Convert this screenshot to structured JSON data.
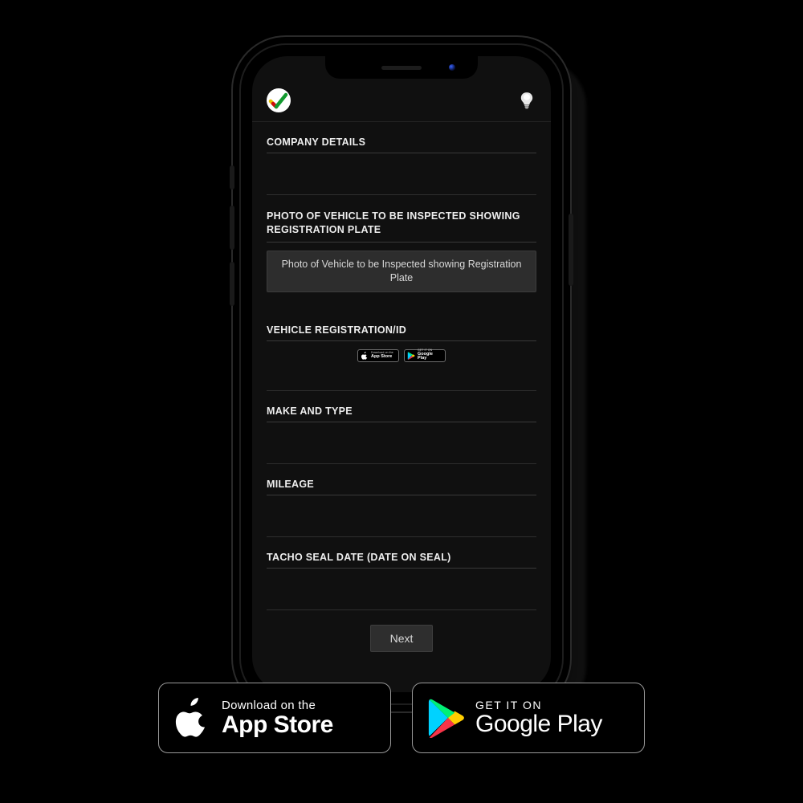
{
  "app": {
    "logo_icon": "check-logo",
    "theme_icon": "bulb-icon"
  },
  "form": {
    "company_label": "COMPANY DETAILS",
    "photo_label": "PHOTO OF VEHICLE TO BE INSPECTED SHOWING REGISTRATION PLATE",
    "photo_button": "Photo of Vehicle to be Inspected showing Registration Plate",
    "reg_label": "VEHICLE REGISTRATION/ID",
    "make_label": "MAKE AND TYPE",
    "mileage_label": "MILEAGE",
    "tacho_label": "TACHO SEAL DATE (DATE ON SEAL)",
    "next_label": "Next"
  },
  "badges": {
    "apple_top": "Download on the",
    "apple_bottom": "App Store",
    "google_top": "GET IT ON",
    "google_bottom": "Google Play"
  }
}
